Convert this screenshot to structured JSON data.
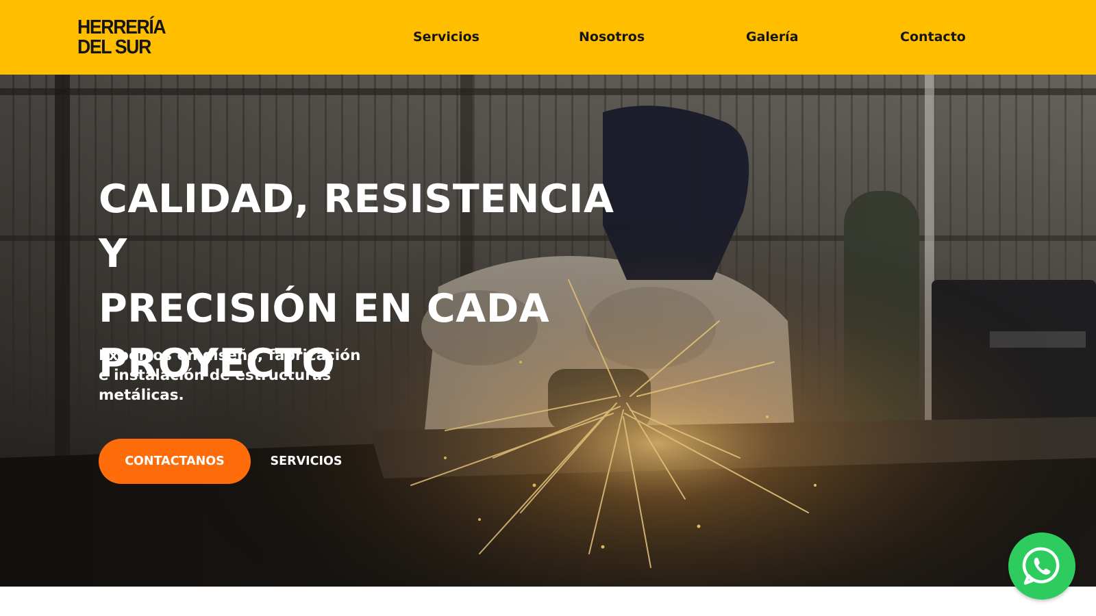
{
  "brand": {
    "logo_line1": "HERRERÍA",
    "logo_line2": "DEL SUR",
    "header_color": "#ffbf00",
    "accent_color": "#ff6d0a",
    "whatsapp_color": "#2ecc5e"
  },
  "nav": {
    "items": [
      {
        "label": "Servicios"
      },
      {
        "label": "Nosotros"
      },
      {
        "label": "Galería"
      },
      {
        "label": "Contacto"
      }
    ]
  },
  "hero": {
    "title_line1": "CALIDAD, RESISTENCIA Y",
    "title_line2": "PRECISIÓN EN CADA",
    "title_line3": "PROYECTO",
    "subtitle": "Expertos en diseño, fabricación e instalación de estructuras metálicas.",
    "primary_cta": "CONTACTANOS",
    "secondary_cta": "SERVICIOS",
    "background_icon": "welder-photo"
  },
  "floating": {
    "whatsapp_icon": "whatsapp-icon"
  }
}
